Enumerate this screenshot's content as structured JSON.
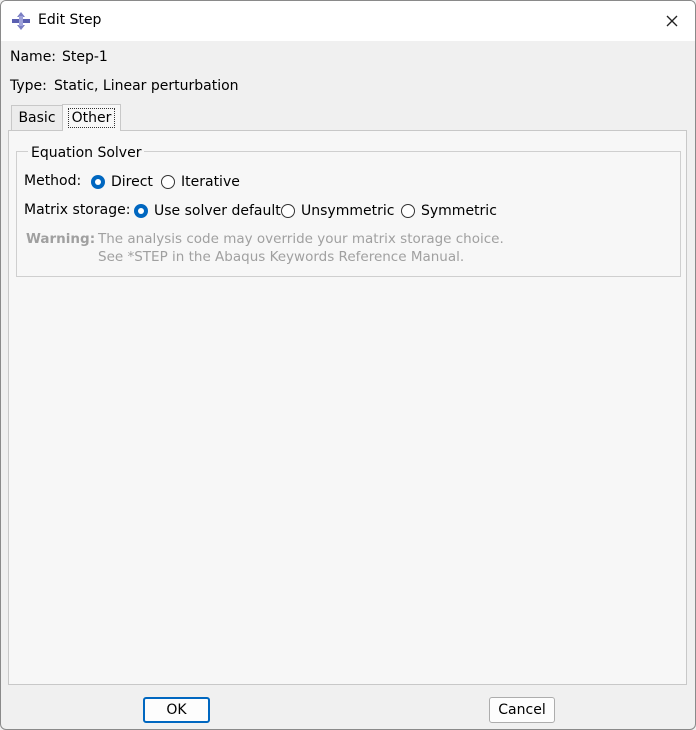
{
  "window": {
    "title": "Edit Step",
    "app_icon": "abaqus-step-icon",
    "close_icon": "close-icon"
  },
  "info": {
    "name_label": "Name:",
    "name_value": "Step-1",
    "type_label": "Type:",
    "type_value": "Static, Linear perturbation"
  },
  "tabs": [
    {
      "label": "Basic",
      "active": false
    },
    {
      "label": "Other",
      "active": true
    }
  ],
  "equation_solver": {
    "title": "Equation Solver",
    "method_label": "Method:",
    "method_options": [
      {
        "label": "Direct",
        "checked": true
      },
      {
        "label": "Iterative",
        "checked": false
      }
    ],
    "matrix_label": "Matrix storage:",
    "matrix_options": [
      {
        "label": "Use solver default",
        "checked": true
      },
      {
        "label": "Unsymmetric",
        "checked": false
      },
      {
        "label": "Symmetric",
        "checked": false
      }
    ],
    "warning_label": "Warning:",
    "warning_line1": "The analysis code may override your matrix storage choice.",
    "warning_line2": "See *STEP in the Abaqus Keywords Reference Manual."
  },
  "buttons": {
    "ok": "OK",
    "cancel": "Cancel"
  },
  "colors": {
    "accent": "#0067c0",
    "disabled_text": "#a0a0a0"
  }
}
